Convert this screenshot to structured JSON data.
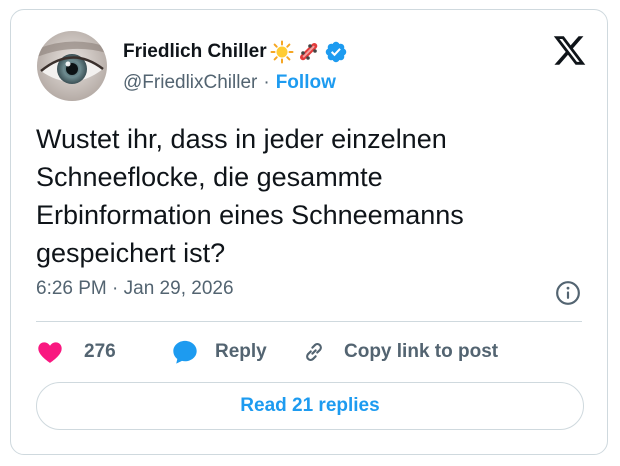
{
  "author": {
    "display_name": "Friedlich Chiller",
    "handle": "@FriedlixChiller",
    "separator": "·",
    "follow_label": "Follow",
    "verified": true,
    "name_emojis": [
      "sun-emoji",
      "skateboard-emoji"
    ]
  },
  "tweet": {
    "text": "Wustet ihr, dass in jeder einzelnen\nSchneeflocke, die gesammte\nErbinformation eines Schneemanns\ngespeichert ist?",
    "timestamp": "6:26 PM · Jan 29, 2026"
  },
  "actions": {
    "likes_count": "276",
    "reply_label": "Reply",
    "copy_link_label": "Copy link to post"
  },
  "footer": {
    "read_replies_label": "Read 21 replies"
  },
  "colors": {
    "accent": "#1d9bf0",
    "like": "#f91880",
    "secondary_text": "#536471",
    "border": "#cfd9de"
  }
}
